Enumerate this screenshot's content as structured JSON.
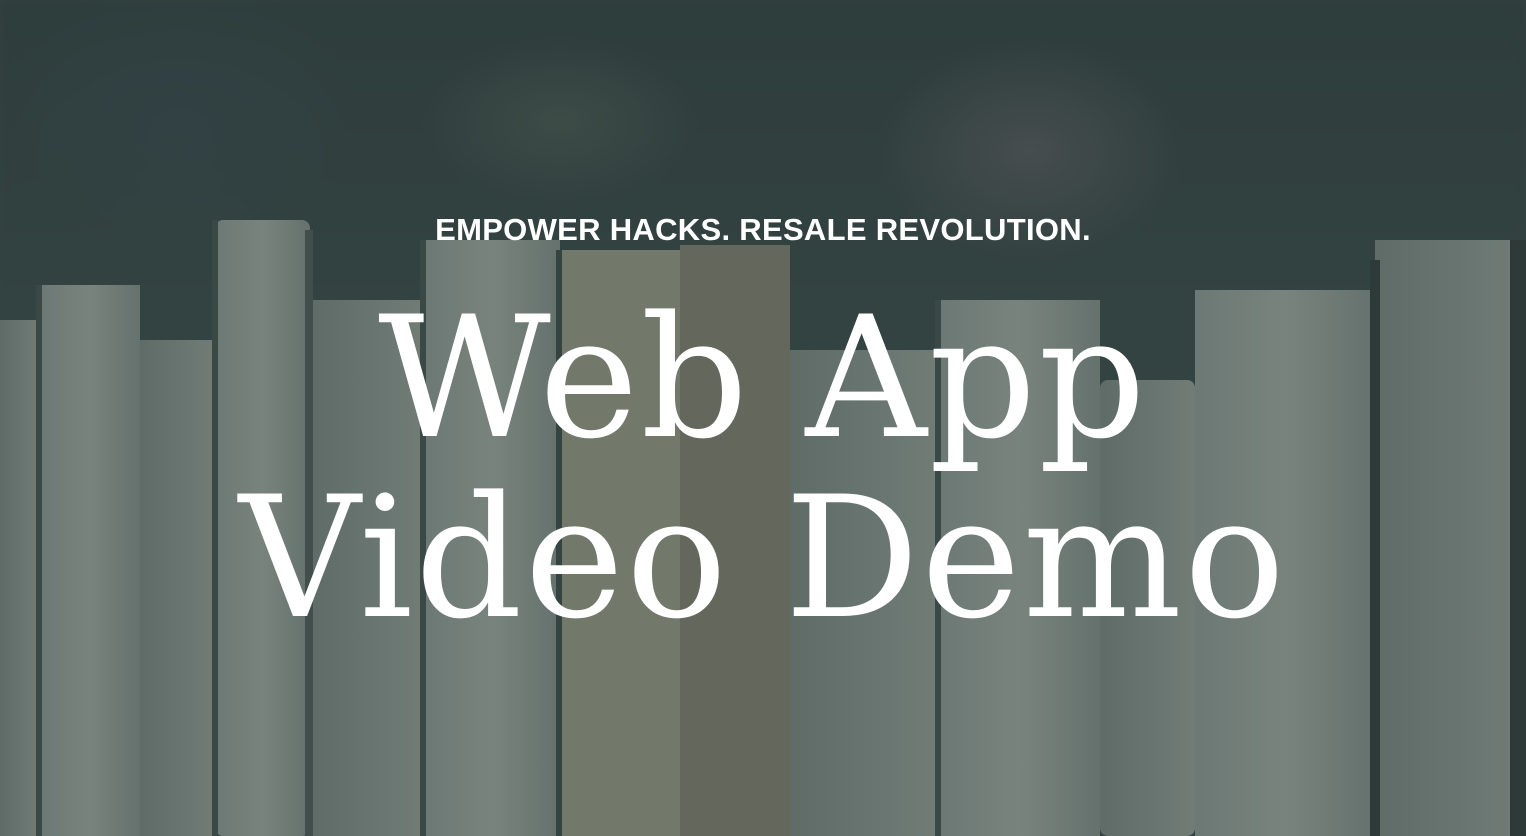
{
  "hero": {
    "tagline": "EMPOWER HACKS. RESALE REVOLUTION.",
    "title_line1": "Web App",
    "title_line2": "Video Demo"
  },
  "colors": {
    "overlay": "#2d3e3c",
    "text": "#ffffff"
  }
}
